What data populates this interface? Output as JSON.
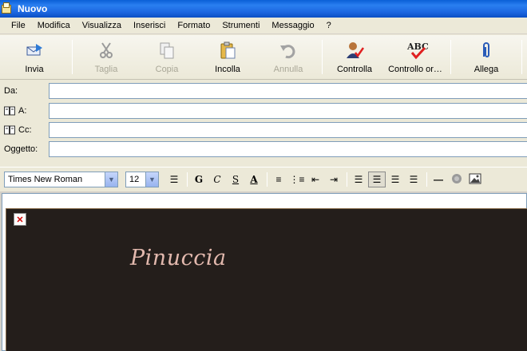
{
  "window": {
    "title": "Nuovo"
  },
  "menu": [
    "File",
    "Modifica",
    "Visualizza",
    "Inserisci",
    "Formato",
    "Strumenti",
    "Messaggio",
    "?"
  ],
  "toolbar": {
    "buttons": [
      {
        "label": "Invia",
        "icon": "send-icon",
        "enabled": true
      },
      {
        "label": "Taglia",
        "icon": "scissors-icon",
        "enabled": false
      },
      {
        "label": "Copia",
        "icon": "copy-icon",
        "enabled": false
      },
      {
        "label": "Incolla",
        "icon": "paste-icon",
        "enabled": true
      },
      {
        "label": "Annulla",
        "icon": "undo-icon",
        "enabled": false
      },
      {
        "label": "Controlla",
        "icon": "check-names-icon",
        "enabled": true
      },
      {
        "label": "Controllo or…",
        "icon": "spelling-icon",
        "enabled": true
      },
      {
        "label": "Allega",
        "icon": "paperclip-icon",
        "enabled": true
      }
    ]
  },
  "fields": {
    "from_label": "Da:",
    "from_value": "",
    "to_label": "A:",
    "to_value": "",
    "cc_label": "Cc:",
    "cc_value": "",
    "subject_label": "Oggetto:",
    "subject_value": ""
  },
  "format": {
    "font_family": "Times New Roman",
    "font_size": "12",
    "bold": "G",
    "italic": "C",
    "underline": "S",
    "font_color": "A"
  },
  "body": {
    "signature": "Pinuccia",
    "background_color": "#241e1b",
    "signature_color": "#e3b9ae"
  },
  "icons_ab": {
    "spell_abc": "ABC"
  }
}
